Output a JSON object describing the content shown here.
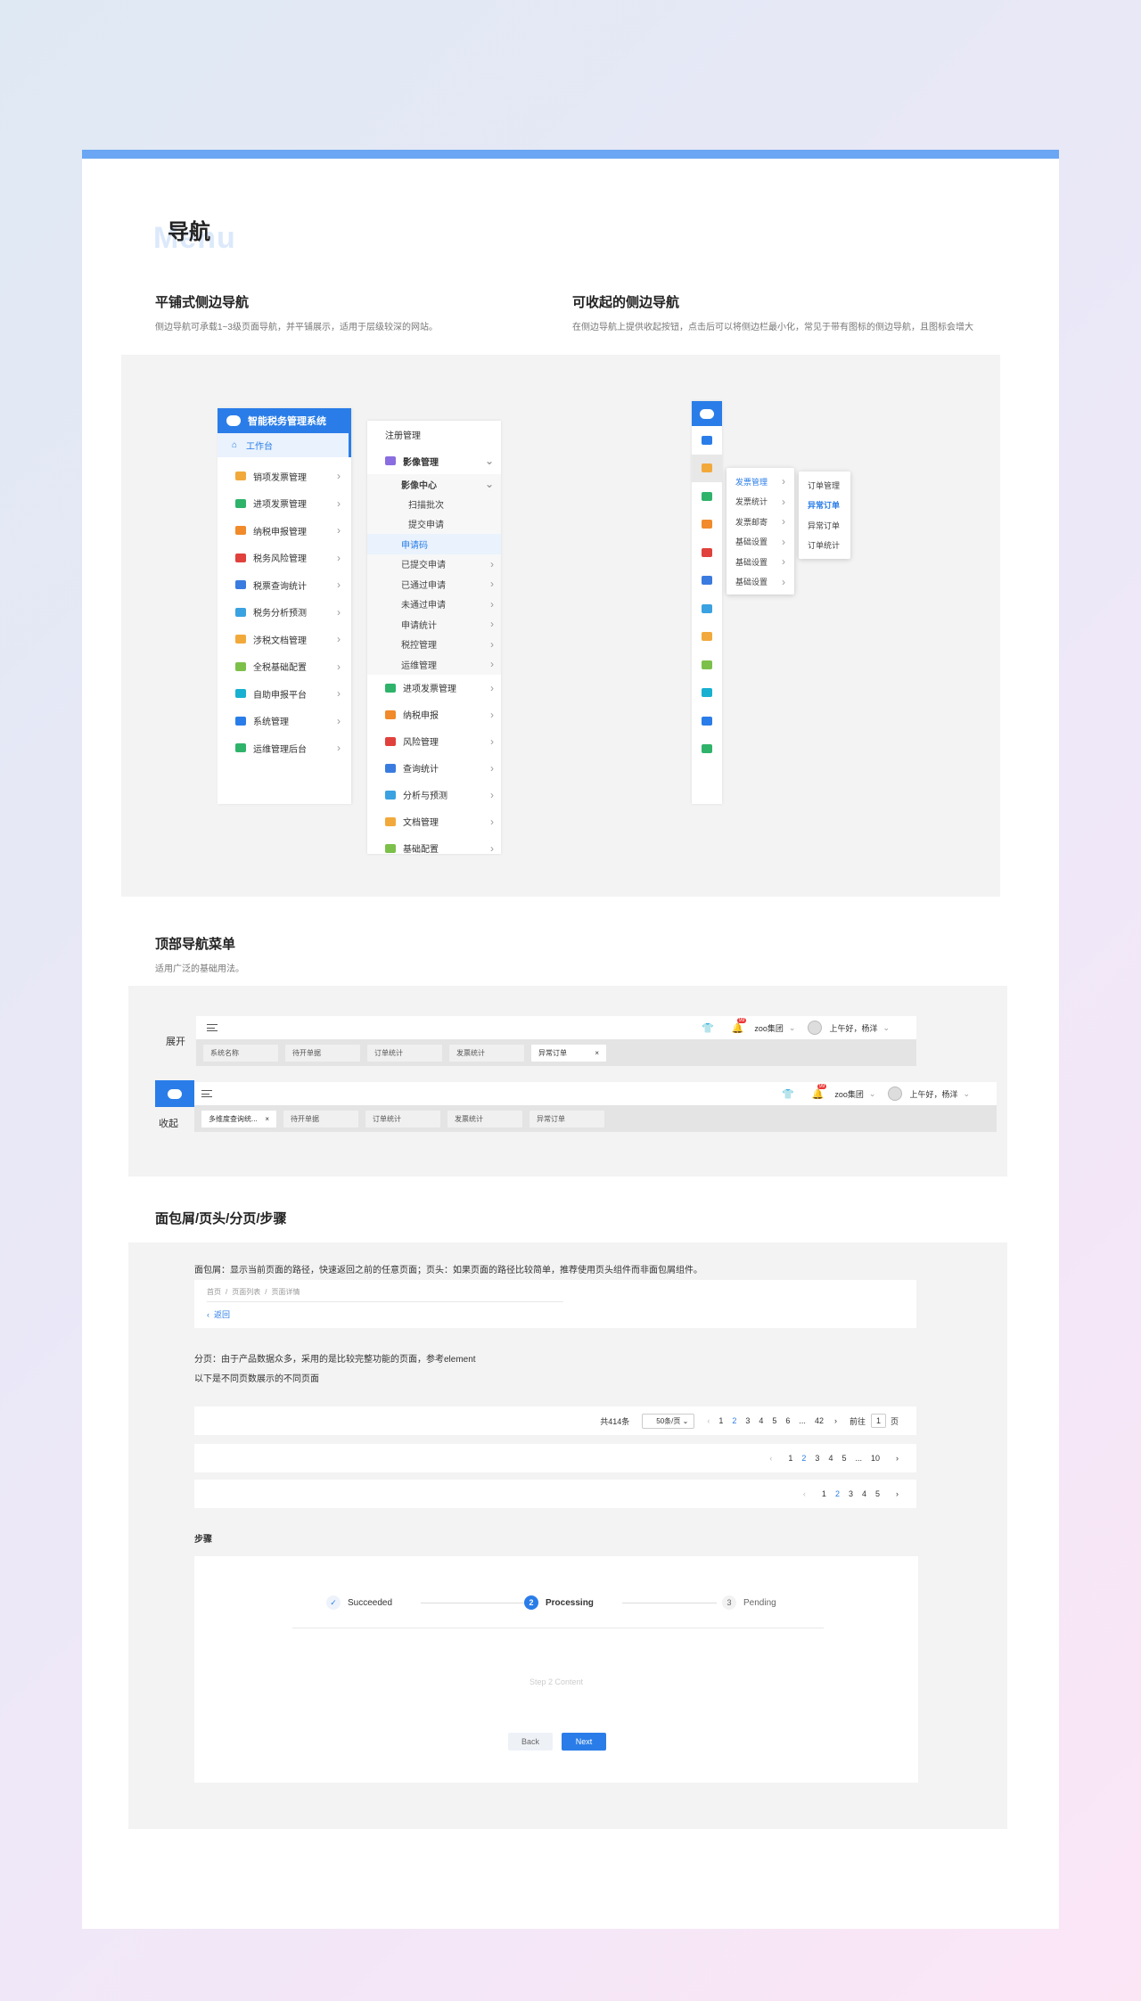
{
  "section": {
    "title": "导航",
    "ghost": "Menu"
  },
  "flat_nav": {
    "title": "平铺式侧边导航",
    "desc": "侧边导航可承载1~3级页面导航，并平铺展示，适用于层级较深的网站。"
  },
  "collapse_nav": {
    "title": "可收起的侧边导航",
    "desc": "在侧边导航上提供收起按钮，点击后可以将侧边栏最小化，常见于带有图标的侧边导航，且图标会增大"
  },
  "sidebar1": {
    "app_title": "智能税务管理系统",
    "workbench": "工作台",
    "items": [
      {
        "label": "销项发票管理",
        "color": "#f2a93b"
      },
      {
        "label": "进项发票管理",
        "color": "#2fb36a"
      },
      {
        "label": "纳税申报管理",
        "color": "#f08a2a"
      },
      {
        "label": "税务风险管理",
        "color": "#e0413c"
      },
      {
        "label": "税票查询统计",
        "color": "#3a7be0"
      },
      {
        "label": "税务分析预测",
        "color": "#3aa2e0"
      },
      {
        "label": "涉税文档管理",
        "color": "#f2a93b"
      },
      {
        "label": "全税基础配置",
        "color": "#7cc04a"
      },
      {
        "label": "自助申报平台",
        "color": "#18b0d0"
      },
      {
        "label": "系统管理",
        "color": "#2a7de8"
      },
      {
        "label": "运维管理后台",
        "color": "#2fb36a"
      }
    ]
  },
  "sidebar2": {
    "top": "注册管理",
    "group": "影像管理",
    "subgroup": "影像中心",
    "sub_items": [
      "扫描批次",
      "提交申请",
      "申请码"
    ],
    "items2": [
      "已提交申请",
      "已通过申请",
      "未通过申请",
      "申请统计",
      "税控管理",
      "运维管理"
    ],
    "items3": [
      "进项发票管理",
      "纳税申报",
      "风险管理",
      "查询统计",
      "分析与预测",
      "文档管理",
      "基础配置"
    ]
  },
  "sidebar3": {
    "flyout1": [
      "发票管理",
      "发票统计",
      "发票邮寄",
      "基础设置",
      "基础设置",
      "基础设置"
    ],
    "flyout2": [
      "订单管理",
      "异常订单",
      "异常订单",
      "订单统计"
    ]
  },
  "topnav": {
    "title": "顶部导航菜单",
    "desc": "适用广泛的基础用法。",
    "expanded_label": "展开",
    "collapsed_label": "收起",
    "badge": "99",
    "org": "zoo集团",
    "greeting": "上午好，杨洋",
    "tabs_expanded": [
      "系统名称",
      "待开单据",
      "订单统计",
      "发票统计",
      "异常订单"
    ],
    "tabs_collapsed": [
      "多维度查询统...",
      "待开单据",
      "订单统计",
      "发票统计",
      "异常订单"
    ],
    "close": "×"
  },
  "breadcrumb_section": {
    "title": "面包屑/页头/分页/步骤",
    "desc": "面包屑：显示当前页面的路径，快速返回之前的任意页面；页头：如果页面的路径比较简单，推荐使用页头组件而非面包屑组件。",
    "crumbs": [
      "首页",
      "页面列表",
      "页面详情"
    ],
    "sep": "/",
    "back": "返回"
  },
  "pagination": {
    "desc1": "分页：由于产品数据众多，采用的是比较完整功能的页面，参考element",
    "desc2": "以下是不同页数展示的不同页面",
    "total": "共414条",
    "page_size": "50条/页",
    "goto": "前往",
    "goto_value": "1",
    "page_unit": "页",
    "ellipsis": "...",
    "row1": [
      "1",
      "2",
      "3",
      "4",
      "5",
      "6",
      "...",
      "42"
    ],
    "row2": [
      "1",
      "2",
      "3",
      "4",
      "5",
      "...",
      "10"
    ],
    "row3": [
      "1",
      "2",
      "3",
      "4",
      "5"
    ],
    "current": "2"
  },
  "steps": {
    "title": "步骤",
    "items": [
      {
        "label": "Succeeded",
        "state": "done"
      },
      {
        "label": "Processing",
        "state": "active",
        "num": "2"
      },
      {
        "label": "Pending",
        "state": "pending",
        "num": "3"
      }
    ],
    "content": "Step 2 Content",
    "back": "Back",
    "next": "Next"
  },
  "colors": {
    "primary": "#2a7de8",
    "accent_bar": "#6aa6f3",
    "panel": "#f3f3f3"
  }
}
